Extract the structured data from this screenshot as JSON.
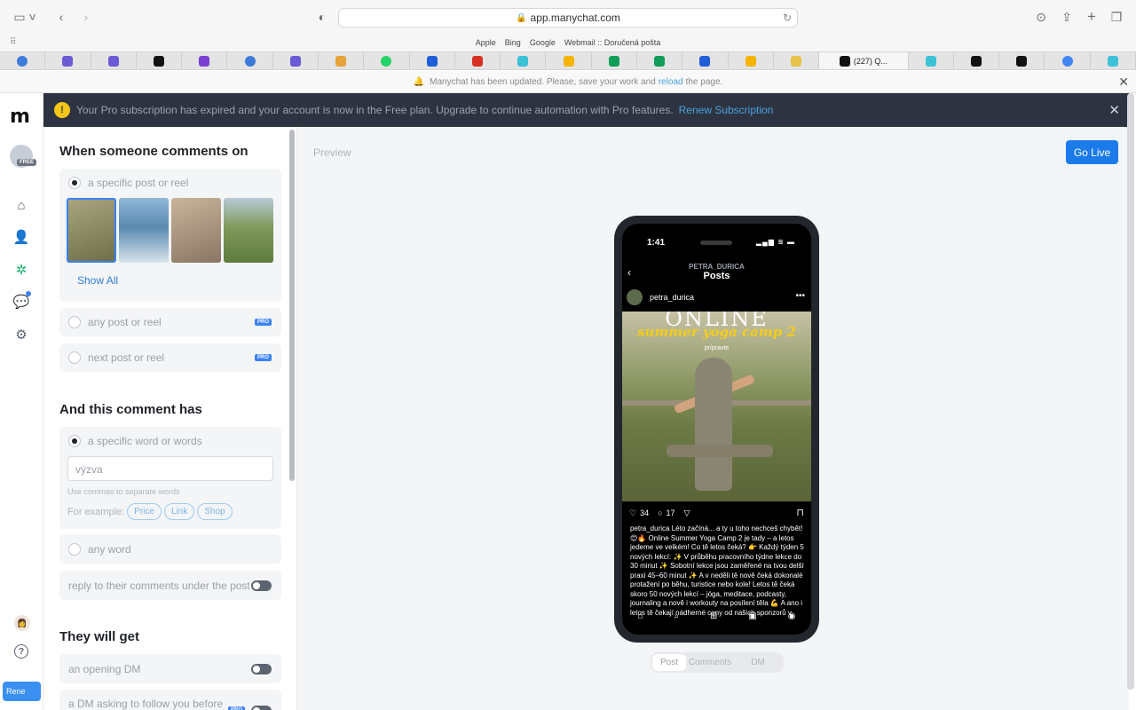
{
  "browser": {
    "url": "app.manychat.com",
    "favorites": [
      "Apple",
      "Bing",
      "Google",
      "Webmail :: Doručená pošta"
    ],
    "active_tab_title": "(227) Q..."
  },
  "notice": {
    "text_before": "Manychat has been updated. Please, save your work and",
    "link": "reload",
    "text_after": "the page."
  },
  "banner": {
    "message": "Your Pro subscription has expired and your account is now in the Free plan. Upgrade to continue automation with Pro features.",
    "link": "Renew Subscription"
  },
  "nav": {
    "logo": "m",
    "plan_badge": "FREE",
    "renew_label": "Rene"
  },
  "trigger": {
    "heading": "When someone comments on",
    "opt_specific": "a specific post or reel",
    "show_all": "Show All",
    "opt_any": "any post or reel",
    "opt_next": "next post or reel",
    "pro": "PRO"
  },
  "comment": {
    "heading": "And this comment has",
    "opt_specific": "a specific word or words",
    "input_value": "výzva",
    "hint": "Use commas to separate words",
    "example_label": "For example:",
    "examples": [
      "Price",
      "Link",
      "Shop"
    ],
    "opt_any": "any word",
    "reply_label": "reply to their comments under the post"
  },
  "get": {
    "heading": "They will get",
    "opening_dm": "an opening DM",
    "follow_dm": "a DM asking to follow you before"
  },
  "preview": {
    "label": "Preview",
    "go_live": "Go Live",
    "tabs": [
      "Post",
      "Comments",
      "DM"
    ]
  },
  "phone": {
    "time": "1:41",
    "account": "PETRA_DURICA",
    "screen_title": "Posts",
    "username": "petra_durica",
    "img_big": "ONLINE",
    "img_script": "summer yoga camp 2",
    "img_small": "prípravte",
    "likes": "34",
    "comments": "17",
    "caption": "petra_durica Léto začíná... a ty u toho nechceš chybět! 😊🔥 Online Summer Yoga Camp 2 je tady – a letos jedeme ve velkém! Co tě letos čeká? 👉 Každý týden 5 nových lekcí: ✨ V průběhu pracovního týdne lekce do 30 minut ✨ Sobotní lekce jsou zaměřené na tvou delší praxi 45–60 minut ✨ A v neděli tě nově čeká dokonalé protažení po běhu, turistice nebo kole! Letos tě čeká skoro 50 nových lekcí – jóga, meditace, podcasty, journaling a nově i workouty na posílení těla 💪 A ano i letos tě čekají nádherné ceny od našich sponzorů v"
  }
}
